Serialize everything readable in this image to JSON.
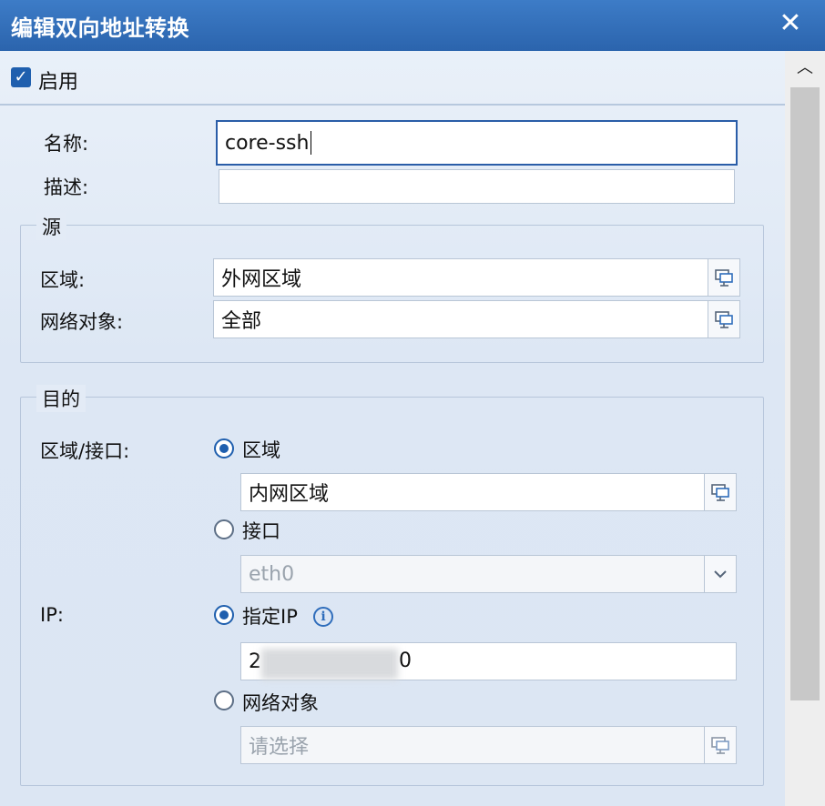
{
  "dialog": {
    "title": "编辑双向地址转换",
    "close_icon": "close-icon"
  },
  "enable": {
    "label": "启用",
    "checked": true
  },
  "form": {
    "name_label": "名称:",
    "name_value": "core-ssh",
    "desc_label": "描述:",
    "desc_value": ""
  },
  "source": {
    "legend": "源",
    "zone_label": "区域:",
    "zone_value": "外网区域",
    "netobj_label": "网络对象:",
    "netobj_value": "全部"
  },
  "destination": {
    "legend": "目的",
    "zone_iface_label": "区域/接口:",
    "radio_zone_label": "区域",
    "radio_zone_selected": true,
    "zone_value": "内网区域",
    "radio_iface_label": "接口",
    "radio_iface_selected": false,
    "iface_value": "eth0",
    "ip_label": "IP:",
    "radio_ip_label": "指定IP",
    "radio_ip_selected": true,
    "ip_value_start": "2",
    "ip_value_end": "0",
    "radio_netobj_label": "网络对象",
    "radio_netobj_selected": false,
    "netobj_placeholder": "请选择"
  },
  "icons": {
    "picker": "object-picker-icon",
    "dropdown": "chevron-down-icon",
    "info": "info-icon",
    "scroll_up": "chevron-up-icon"
  }
}
